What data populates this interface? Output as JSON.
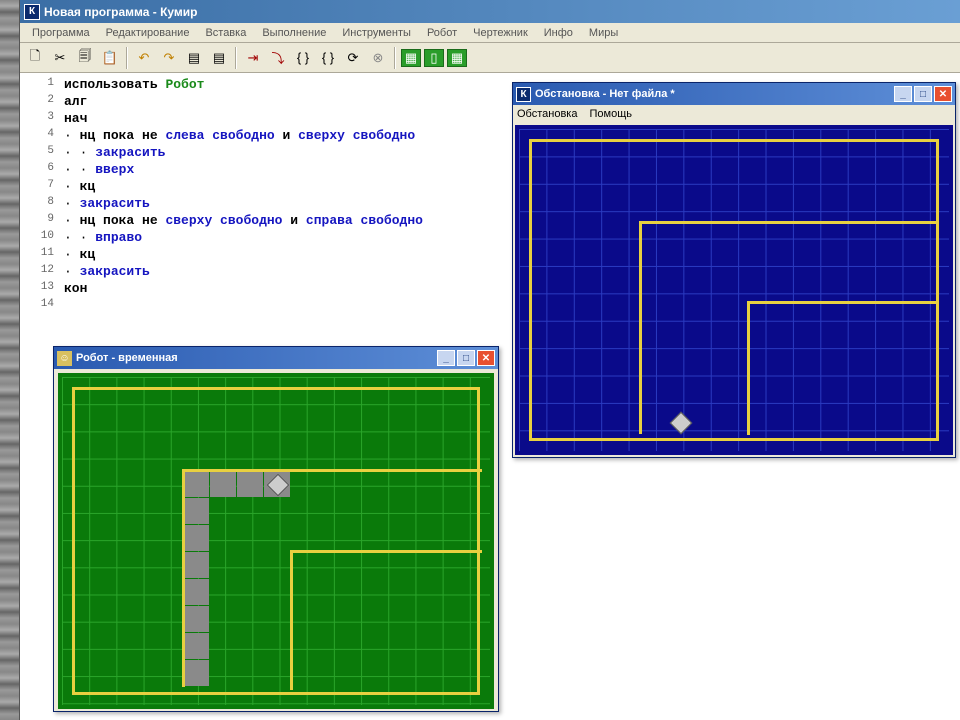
{
  "app": {
    "icon_letter": "К",
    "title": "Новая программа - Кумир"
  },
  "menu": [
    "Программа",
    "Редактирование",
    "Вставка",
    "Выполнение",
    "Инструменты",
    "Робот",
    "Чертежник",
    "Инфо",
    "Миры"
  ],
  "toolbar_icons": {
    "new": "🗋",
    "cut": "✂",
    "copy": "🗐",
    "paste": "📋",
    "undo": "↶",
    "redo": "↷",
    "doc1": "▤",
    "doc2": "▤",
    "step_in": "⇥",
    "step_over": "⤵",
    "brace1": "{ }",
    "brace2": "{ }",
    "cont": "⟳",
    "stop": "⊗"
  },
  "code": {
    "use": "использовать",
    "robot_name": "Робот",
    "alg": "алг",
    "begin": "нач",
    "loop_while_not": "нц пока не",
    "left_free": "слева свободно",
    "and": "и",
    "top_free": "сверху свободно",
    "paint": "закрасить",
    "up": "вверх",
    "endloop": "кц",
    "right_free": "справа свободно",
    "right": "вправо",
    "end": "кон",
    "dot": "·"
  },
  "line_numbers": [
    "1",
    "2",
    "3",
    "4",
    "5",
    "6",
    "7",
    "8",
    "9",
    "10",
    "11",
    "12",
    "13",
    "14"
  ],
  "robot_window": {
    "icon": "☺",
    "title": "Робот - временная"
  },
  "env_window": {
    "icon_letter": "К",
    "title": "Обстановка - Нет файла *",
    "menu": [
      "Обстановка",
      "Помощь"
    ]
  },
  "win_buttons": {
    "min": "_",
    "max": "□",
    "close": "✕"
  }
}
